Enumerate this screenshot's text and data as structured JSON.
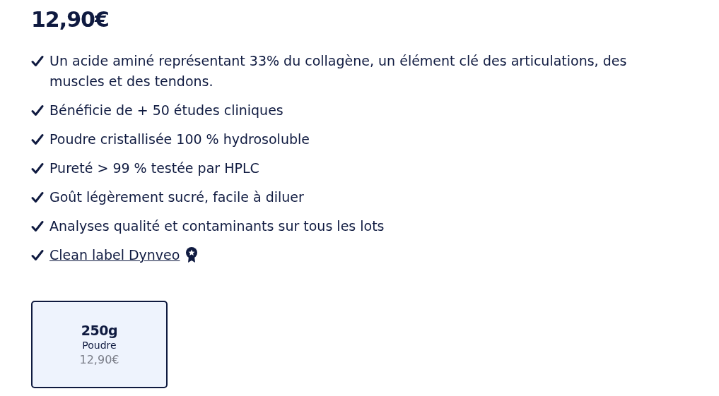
{
  "price": "12,90€",
  "features": [
    {
      "kind": "text",
      "text": "Un acide aminé représentant 33% du collagène, un élément clé des articulations, des muscles et des tendons."
    },
    {
      "kind": "text",
      "text": "Bénéficie de + 50 études cliniques"
    },
    {
      "kind": "text",
      "text": "Poudre cristallisée 100 % hydrosoluble"
    },
    {
      "kind": "text",
      "text": "Pureté > 99 % testée par HPLC"
    },
    {
      "kind": "text",
      "text": "Goût légèrement sucré, facile à diluer"
    },
    {
      "kind": "text",
      "text": "Analyses qualité et contaminants sur tous les lots"
    },
    {
      "kind": "link",
      "text": "Clean label Dynveo"
    }
  ],
  "variants": [
    {
      "size": "250g",
      "form": "Poudre",
      "price": "12,90€",
      "selected": true
    }
  ]
}
